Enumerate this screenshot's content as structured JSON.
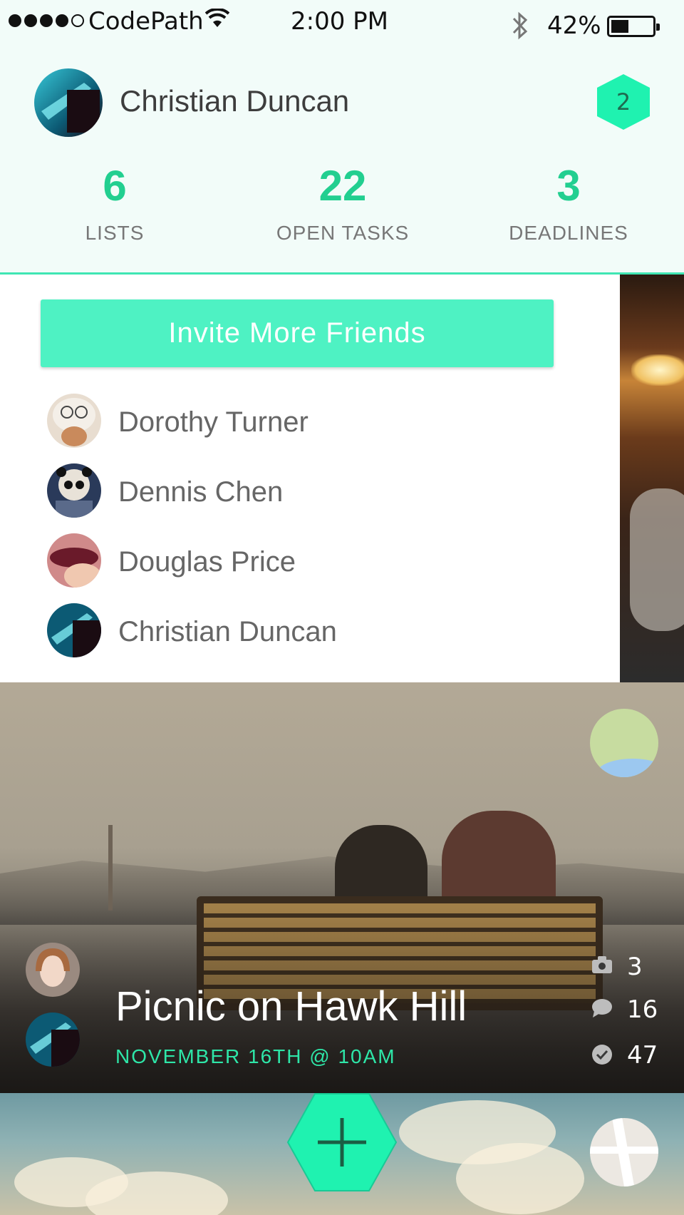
{
  "status_bar": {
    "carrier": "CodePath",
    "time": "2:00 PM",
    "battery": "42%",
    "battery_level": 0.42
  },
  "header": {
    "user_name": "Christian Duncan",
    "notification_count": "2"
  },
  "stats": [
    {
      "value": "6",
      "label": "LISTS"
    },
    {
      "value": "22",
      "label": "OPEN TASKS"
    },
    {
      "value": "3",
      "label": "DEADLINES"
    }
  ],
  "friends_panel": {
    "invite_label": "Invite More Friends",
    "friends": [
      {
        "name": "Dorothy Turner"
      },
      {
        "name": "Dennis Chen"
      },
      {
        "name": "Douglas Price"
      },
      {
        "name": "Christian Duncan"
      }
    ]
  },
  "event": {
    "title": "Picnic on Hawk Hill",
    "date": "NOVEMBER 16TH @ 10AM",
    "photos": "3",
    "comments": "16",
    "completed": "47"
  },
  "colors": {
    "accent": "#22cf90",
    "button": "#4ef2c3",
    "hexagon": "#1ff2b0",
    "header_bg": "#f2fcf9"
  },
  "icons": [
    "wifi-icon",
    "bluetooth-icon",
    "battery-icon",
    "notification-hexagon-icon",
    "camera-icon",
    "comment-icon",
    "checkmark-icon",
    "plus-icon"
  ]
}
